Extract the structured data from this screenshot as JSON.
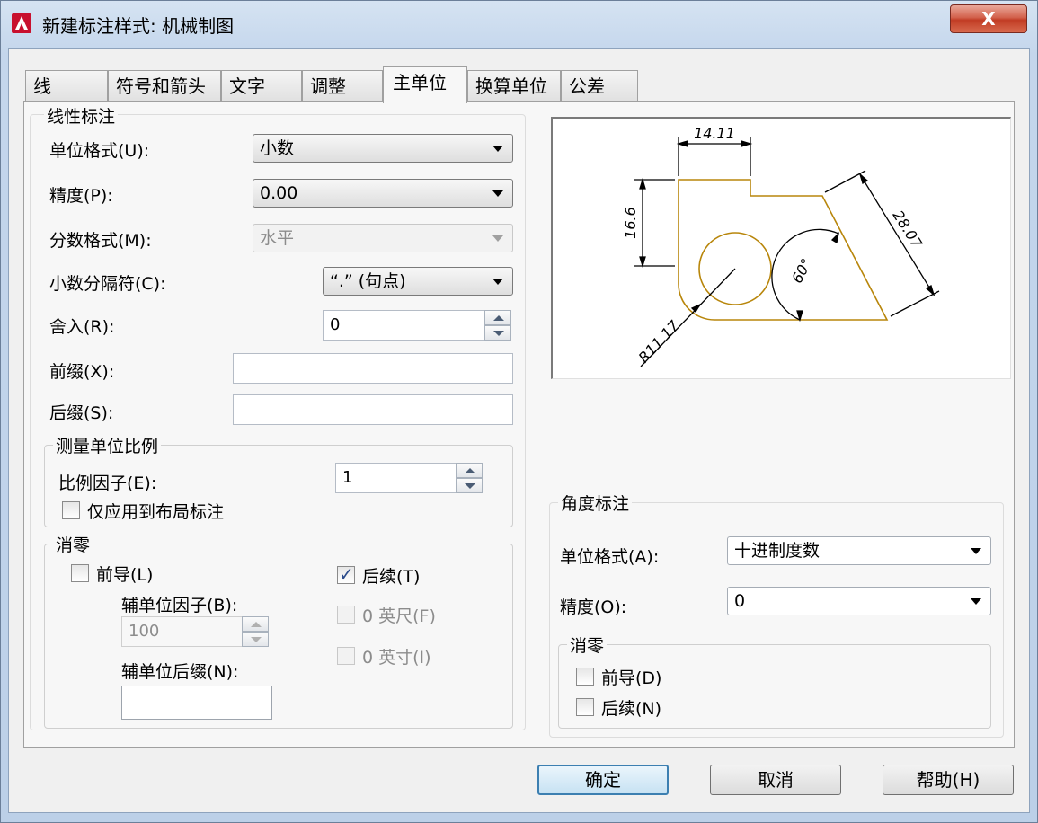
{
  "window": {
    "title": "新建标注样式: 机械制图",
    "close_label": "X"
  },
  "tabs": [
    {
      "label": "线"
    },
    {
      "label": "符号和箭头"
    },
    {
      "label": "文字"
    },
    {
      "label": "调整"
    },
    {
      "label": "主单位",
      "active": true
    },
    {
      "label": "换算单位"
    },
    {
      "label": "公差"
    }
  ],
  "linear": {
    "group_title": "线性标注",
    "unit_format_label": "单位格式(U):",
    "unit_format_value": "小数",
    "precision_label": "精度(P):",
    "precision_value": "0.00",
    "fraction_format_label": "分数格式(M):",
    "fraction_format_value": "水平",
    "decimal_separator_label": "小数分隔符(C):",
    "decimal_separator_value": "“.” (句点)",
    "round_label": "舍入(R):",
    "round_value": "0",
    "prefix_label": "前缀(X):",
    "prefix_value": "",
    "suffix_label": "后缀(S):",
    "suffix_value": ""
  },
  "scale": {
    "group_title": "测量单位比例",
    "factor_label": "比例因子(E):",
    "factor_value": "1",
    "layout_only_label": "仅应用到布局标注",
    "layout_only_checked": false
  },
  "zero_linear": {
    "group_title": "消零",
    "leading_label": "前导(L)",
    "leading_checked": false,
    "sub_factor_label": "辅单位因子(B):",
    "sub_factor_value": "100",
    "sub_suffix_label": "辅单位后缀(N):",
    "sub_suffix_value": "",
    "trailing_label": "后续(T)",
    "trailing_checked": true,
    "feet_label": "0 英尺(F)",
    "inches_label": "0 英寸(I)"
  },
  "preview": {
    "dim_top": "14.11",
    "dim_left": "16.6",
    "dim_diag": "28.07",
    "dim_angle": "60°",
    "dim_radius": "R11.17",
    "line_color": "#b8860b"
  },
  "angular": {
    "group_title": "角度标注",
    "unit_format_label": "单位格式(A):",
    "unit_format_value": "十进制度数",
    "precision_label": "精度(O):",
    "precision_value": "0"
  },
  "zero_angular": {
    "group_title": "消零",
    "leading_label": "前导(D)",
    "leading_checked": false,
    "trailing_label": "后续(N)",
    "trailing_checked": false
  },
  "buttons": {
    "ok": "确定",
    "cancel": "取消",
    "help": "帮助(H)"
  }
}
